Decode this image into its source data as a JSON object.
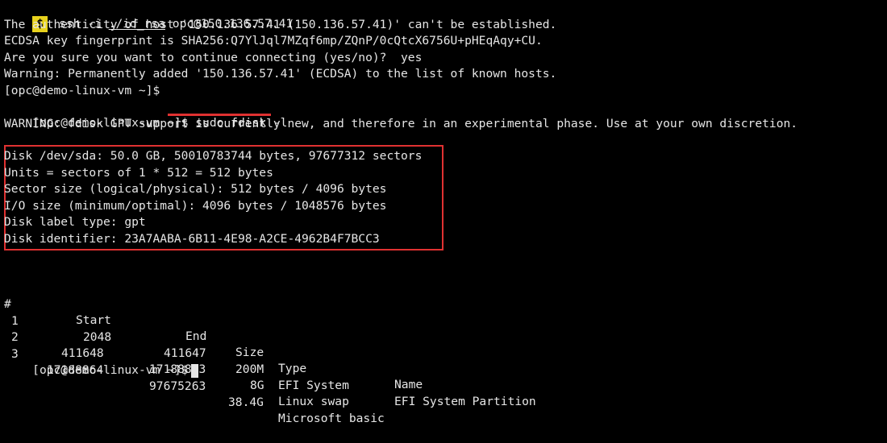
{
  "terminal": {
    "prompt_symbol": "$",
    "ssh_command": {
      "cmd": "ssh",
      "flag": "-i",
      "key_file": "./id_rsa",
      "target": "opc@150.136.57.41"
    },
    "lines": [
      "The authenticity of host '150.136.57.41 (150.136.57.41)' can't be established.",
      "ECDSA key fingerprint is SHA256:Q7YlJql7MZqf6mp/ZQnP/0cQtcX6756U+pHEqAqy+CU.",
      "Are you sure you want to continue connecting (yes/no)?  yes",
      "Warning: Permanently added '150.136.57.41' (ECDSA) to the list of known hosts.",
      "[opc@demo-linux-vm ~]$"
    ],
    "fdisk_prompt": "[opc@demo-linux-vm ~]$",
    "fdisk_command": "sudo fdisk -l",
    "warning_line": "WARNING: fdisk GPT support is currently new, and therefore in an experimental phase. Use at your own discretion.",
    "disk_info": [
      "Disk /dev/sda: 50.0 GB, 50010783744 bytes, 97677312 sectors",
      "Units = sectors of 1 * 512 = 512 bytes",
      "Sector size (logical/physical): 512 bytes / 4096 bytes",
      "I/O size (minimum/optimal): 4096 bytes / 1048576 bytes",
      "Disk label type: gpt",
      "Disk identifier: 23A7AABA-6B11-4E98-A2CE-4962B4F7BCC3"
    ],
    "partition_table": {
      "headers": [
        "#",
        "Start",
        "End",
        "Size",
        "Type",
        "Name"
      ],
      "rows": [
        [
          "1",
          "2048",
          "411647",
          "200M",
          "EFI System",
          "EFI System Partition"
        ],
        [
          "2",
          "411648",
          "17188863",
          "8G",
          "Linux swap",
          ""
        ],
        [
          "3",
          "17188864",
          "97675263",
          "38.4G",
          "Microsoft basic",
          ""
        ]
      ]
    },
    "final_prompt": "[opc@demo-linux-vm ~]$"
  },
  "colors": {
    "background": "#000000",
    "text": "#e6e6e6",
    "prompt_badge": "#e8d21d",
    "annotation_red": "#e03131"
  }
}
